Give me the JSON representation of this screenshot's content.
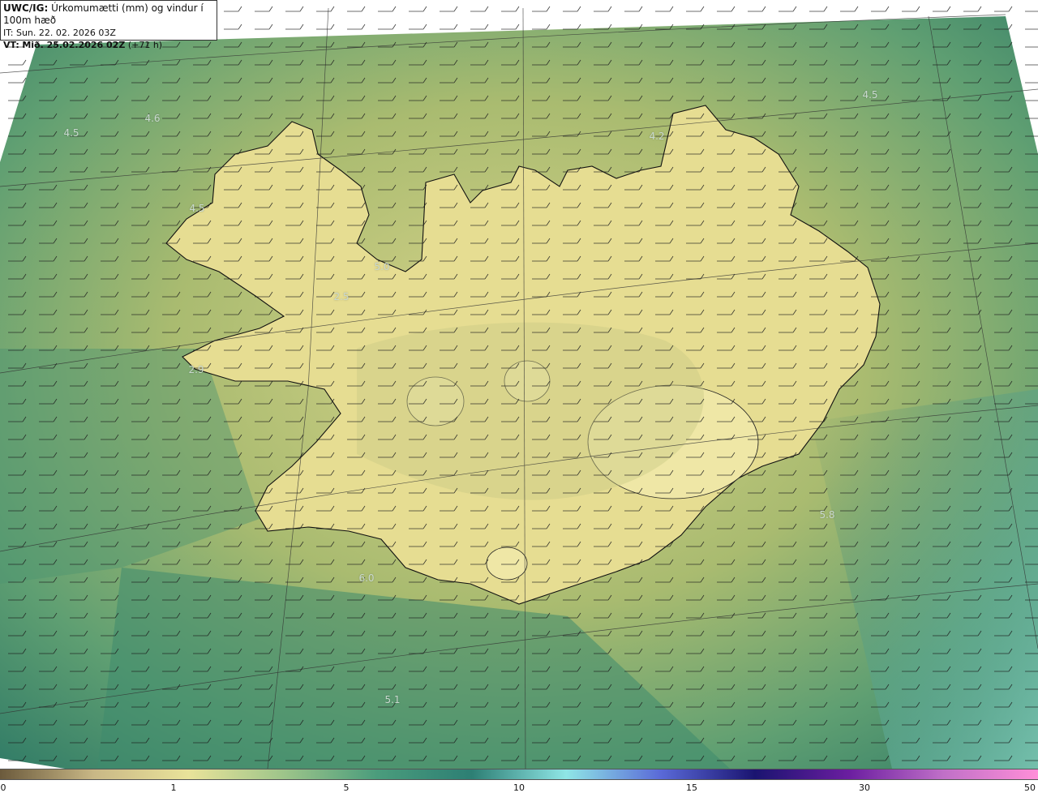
{
  "header": {
    "model": "UWC/IG:",
    "field": "Úrkomumætti (mm) og vindur í 100m hæð",
    "init_label": "IT:",
    "init_time": "Sun. 22. 02. 2026 03Z",
    "valid_label": "VT:",
    "valid_time": "Mið. 25.02.2026 02Z",
    "lead": "(+71 h)"
  },
  "labels": [
    "4.6",
    "4.5",
    "4.5",
    "4.2",
    "4.5",
    "5.0",
    "2.5",
    "2.9",
    "5.8",
    "6.0",
    "5.1"
  ],
  "colorbar": {
    "ticks": [
      "0",
      "1",
      "5",
      "10",
      "15",
      "30",
      "50"
    ],
    "colors": [
      "#6b5a3c",
      "#c9b886",
      "#e9e39a",
      "#9ec58a",
      "#4a9c7c",
      "#2d7f74",
      "#8fe6e6",
      "#5a6ad8",
      "#1a1470",
      "#6b1ea0",
      "#c070c8",
      "#ff8fd8"
    ]
  },
  "colors": {
    "land": "#e4dc8f",
    "sea_light": "#b5c06e",
    "sea_dark": "#3f8a6a",
    "coast": "#111111"
  }
}
